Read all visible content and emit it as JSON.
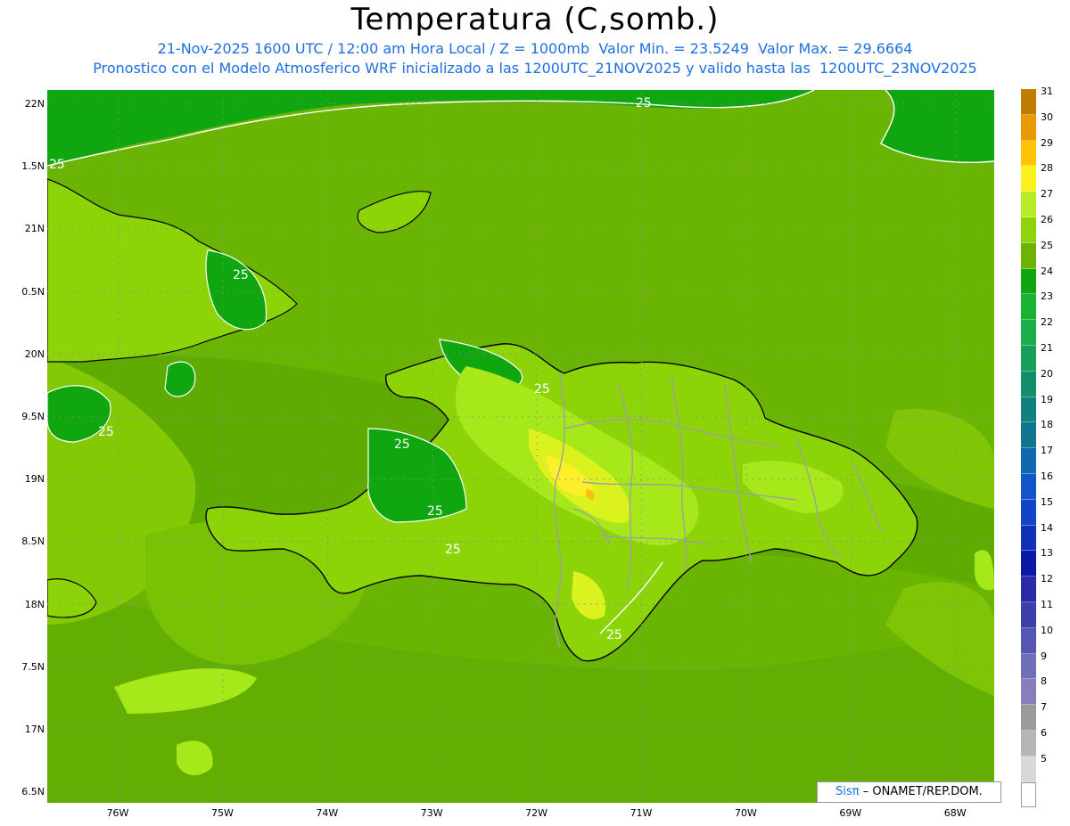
{
  "header": {
    "title": "Temperatura (C,somb.)",
    "subtitle_1": "21-Nov-2025 1600 UTC / 12:00 am Hora Local / Z = 1000mb  Valor Min. = 23.5249  Valor Max. = 29.6664",
    "subtitle_2": "Pronostico con el Modelo Atmosferico WRF inicializado a las 1200UTC_21NOV2025 y valido hasta las  1200UTC_23NOV2025"
  },
  "map": {
    "lat_labels": [
      "22N",
      "1.5N",
      "21N",
      "0.5N",
      "20N",
      "9.5N",
      "19N",
      "8.5N",
      "18N",
      "7.5N",
      "17N",
      "6.5N"
    ],
    "lon_labels": [
      "76W",
      "75W",
      "74W",
      "73W",
      "72W",
      "71W",
      "70W",
      "69W",
      "68W"
    ],
    "contour_label": "25",
    "colors": {
      "sea_base": "#6ab404",
      "warm_sea": "#8cd308",
      "cool_sea": "#59a300",
      "band_24": "#10a610",
      "land_27": "#a6e81a",
      "land_28": "#dcf21e",
      "land_29": "#fdf02a",
      "land_30": "#f7c210",
      "coastline": "#000000",
      "borders": "#a0a0a0",
      "contour": "#ffffff"
    }
  },
  "colorbar": {
    "levels": [
      "31",
      "30",
      "29",
      "28",
      "27",
      "26",
      "25",
      "24",
      "23",
      "22",
      "21",
      "20",
      "19",
      "18",
      "17",
      "16",
      "15",
      "14",
      "13",
      "12",
      "11",
      "10",
      "9",
      "8",
      "7",
      "6",
      "5"
    ],
    "colors": [
      "#c07e00",
      "#e89a00",
      "#ffc300",
      "#fbf21c",
      "#b6ec25",
      "#8fd30b",
      "#6db303",
      "#10a610",
      "#19b433",
      "#1cae4a",
      "#179e58",
      "#138e6a",
      "#108080",
      "#127590",
      "#1068b0",
      "#1455c8",
      "#1344c8",
      "#1030b8",
      "#0a18a8",
      "#2a2aa8",
      "#3d40a8",
      "#5556b0",
      "#6e70b8",
      "#8a7eb8",
      "#9a9a9a",
      "#b6b6b6",
      "#d8d8d8"
    ],
    "bottom_color": "#ffffff"
  },
  "credit": {
    "brand": "Sisπ",
    "text": "– ONAMET/REP.DOM."
  }
}
